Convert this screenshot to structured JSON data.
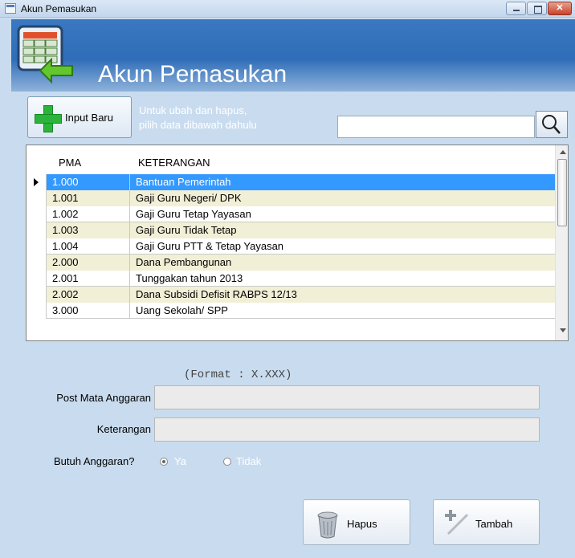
{
  "window": {
    "title": "Akun Pemasukan"
  },
  "header": {
    "title": "Akun Pemasukan"
  },
  "toolbar": {
    "input_baru_label": "Input Baru",
    "hint_line1": "Untuk ubah dan hapus,",
    "hint_line2": "pilih data dibawah dahulu",
    "search_value": ""
  },
  "grid": {
    "columns": [
      "PMA",
      "KETERANGAN"
    ],
    "rows": [
      {
        "pma": "1.000",
        "keterangan": "Bantuan Pemerintah"
      },
      {
        "pma": "1.001",
        "keterangan": "Gaji Guru Negeri/ DPK"
      },
      {
        "pma": "1.002",
        "keterangan": "Gaji Guru Tetap Yayasan"
      },
      {
        "pma": "1.003",
        "keterangan": "Gaji Guru Tidak Tetap"
      },
      {
        "pma": "1.004",
        "keterangan": "Gaji Guru PTT & Tetap Yayasan"
      },
      {
        "pma": "2.000",
        "keterangan": "Dana Pembangunan"
      },
      {
        "pma": "2.001",
        "keterangan": "Tunggakan tahun 2013"
      },
      {
        "pma": "2.002",
        "keterangan": "Dana Subsidi Defisit RABPS 12/13"
      },
      {
        "pma": "3.000",
        "keterangan": "Uang Sekolah/ SPP"
      }
    ],
    "selected_index": 0
  },
  "form": {
    "format_hint": "(Format : X.XXX)",
    "pma_label": "Post Mata Anggaran",
    "pma_value": "",
    "keterangan_label": "Keterangan",
    "keterangan_value": "",
    "butuh_label": "Butuh Anggaran?",
    "option_ya": "Ya",
    "option_tidak": "Tidak",
    "selected_option": "Ya"
  },
  "actions": {
    "hapus_label": "Hapus",
    "tambah_label": "Tambah"
  },
  "colors": {
    "background": "#c9dcef",
    "header": "#2f6db8",
    "row_alt": "#f1efd6",
    "row_selected": "#3399ff"
  }
}
